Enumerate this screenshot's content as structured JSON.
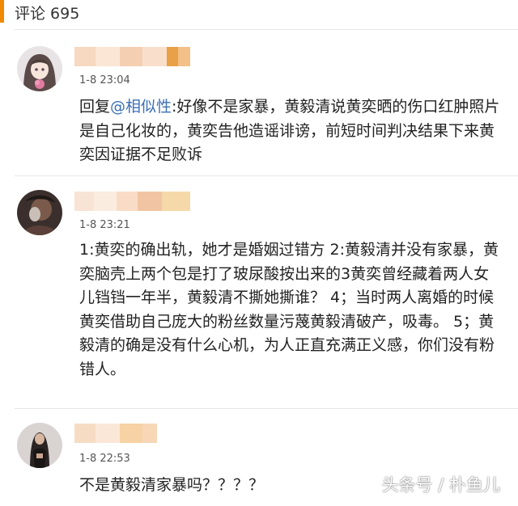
{
  "header": {
    "title": "评论 695"
  },
  "comments": [
    {
      "time": "1-8 23:04",
      "reply_prefix": "回复",
      "mention": "@相似性",
      "text": ":好像不是家暴，黄毅清说黄奕晒的伤口红肿照片是自己化妆的，黄奕告他造谣诽谤，前短时间判决结果下来黄奕因证据不足败诉"
    },
    {
      "time": "1-8 23:21",
      "text": "1:黄奕的确出轨，她才是婚姻过错方 2:黄毅清并没有家暴，黄奕脑壳上两个包是打了玻尿酸按出来的3黄奕曾经藏着两人女儿铛铛一年半，黄毅清不撕她撕谁？ 4；当时两人离婚的时候黄奕借助自己庞大的粉丝数量污蔑黄毅清破产，吸毒。 5；黄毅清的确是没有什么心机，为人正直充满正义感，你们没有粉错人。"
    },
    {
      "time": "1-8 22:53",
      "text": "不是黄毅清家暴吗？？？？"
    }
  ],
  "watermark": "头条号 / 朴鱼儿",
  "colors": {
    "accent": "#f08a00",
    "mention": "#3b6fb6"
  }
}
